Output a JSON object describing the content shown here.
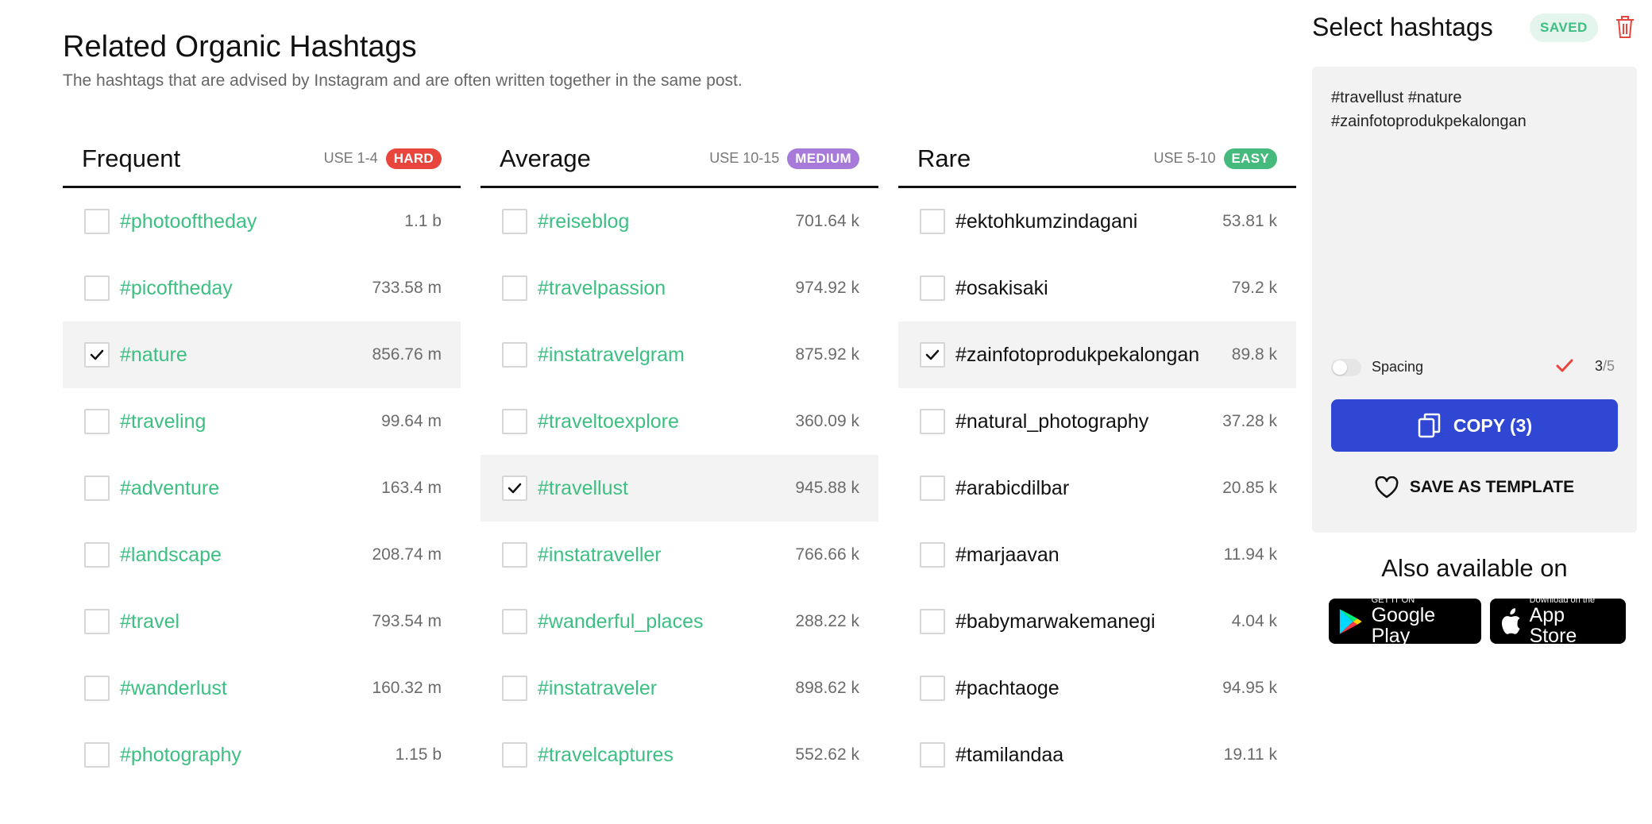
{
  "header": {
    "title": "Related Organic Hashtags",
    "subtitle": "The hashtags that are advised by Instagram and are often written together in the same post."
  },
  "columns": [
    {
      "title": "Frequent",
      "use": "USE 1-4",
      "badge": "HARD",
      "badge_color": "#e8453c",
      "rows": [
        {
          "tag": "#photooftheday",
          "count": "1.1 b",
          "checked": false
        },
        {
          "tag": "#picoftheday",
          "count": "733.58 m",
          "checked": false
        },
        {
          "tag": "#nature",
          "count": "856.76 m",
          "checked": true
        },
        {
          "tag": "#traveling",
          "count": "99.64 m",
          "checked": false
        },
        {
          "tag": "#adventure",
          "count": "163.4 m",
          "checked": false
        },
        {
          "tag": "#landscape",
          "count": "208.74 m",
          "checked": false
        },
        {
          "tag": "#travel",
          "count": "793.54 m",
          "checked": false
        },
        {
          "tag": "#wanderlust",
          "count": "160.32 m",
          "checked": false
        },
        {
          "tag": "#photography",
          "count": "1.15 b",
          "checked": false
        }
      ]
    },
    {
      "title": "Average",
      "use": "USE 10-15",
      "badge": "MEDIUM",
      "badge_color": "#a77ad9",
      "rows": [
        {
          "tag": "#reiseblog",
          "count": "701.64 k",
          "checked": false
        },
        {
          "tag": "#travelpassion",
          "count": "974.92 k",
          "checked": false
        },
        {
          "tag": "#instatravelgram",
          "count": "875.92 k",
          "checked": false
        },
        {
          "tag": "#traveltoexplore",
          "count": "360.09 k",
          "checked": false
        },
        {
          "tag": "#travellust",
          "count": "945.88 k",
          "checked": true
        },
        {
          "tag": "#instatraveller",
          "count": "766.66 k",
          "checked": false
        },
        {
          "tag": "#wanderful_places",
          "count": "288.22 k",
          "checked": false
        },
        {
          "tag": "#instatraveler",
          "count": "898.62 k",
          "checked": false
        },
        {
          "tag": "#travelcaptures",
          "count": "552.62 k",
          "checked": false
        }
      ]
    },
    {
      "title": "Rare",
      "use": "USE 5-10",
      "badge": "EASY",
      "badge_color": "#46b97c",
      "rows": [
        {
          "tag": "#ektohkumzindagani",
          "count": "53.81 k",
          "checked": false
        },
        {
          "tag": "#osakisaki",
          "count": "79.2 k",
          "checked": false
        },
        {
          "tag": "#zainfotoprodukpekalongan",
          "count": "89.8 k",
          "checked": true
        },
        {
          "tag": "#natural_photography",
          "count": "37.28 k",
          "checked": false
        },
        {
          "tag": "#arabicdilbar",
          "count": "20.85 k",
          "checked": false
        },
        {
          "tag": "#marjaavan",
          "count": "11.94 k",
          "checked": false
        },
        {
          "tag": "#babymarwakemanegi",
          "count": "4.04 k",
          "checked": false
        },
        {
          "tag": "#pachtaoge",
          "count": "94.95 k",
          "checked": false
        },
        {
          "tag": "#tamilandaa",
          "count": "19.11 k",
          "checked": false
        }
      ]
    }
  ],
  "panel": {
    "title": "Select hashtags",
    "saved_badge": "SAVED",
    "selected_text": "#travellust #nature #zainfotoprodukpekalongan",
    "spacing_label": "Spacing",
    "selected_count": "3",
    "max_count": "/5",
    "copy_label": "COPY (3)",
    "template_label": "SAVE AS TEMPLATE",
    "accent_color": "#2f47d3"
  },
  "stores": {
    "heading": "Also available on",
    "google_small": "GET IT ON",
    "google_big": "Google Play",
    "apple_small": "Download on the",
    "apple_big": "App Store"
  }
}
